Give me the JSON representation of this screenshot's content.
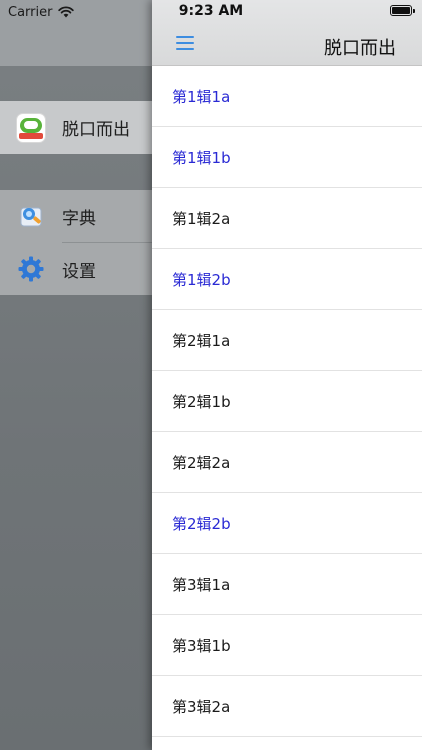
{
  "status_bar": {
    "carrier": "Carrier",
    "time": "9:23 AM"
  },
  "drawer": {
    "main_item": {
      "label": "脱口而出",
      "icon": "app-icon"
    },
    "items": [
      {
        "label": "字典",
        "icon": "dictionary-icon"
      },
      {
        "label": "设置",
        "icon": "gear-icon"
      }
    ]
  },
  "panel": {
    "title": "脱口而出",
    "menu_icon": "hamburger-icon",
    "list": [
      {
        "label": "第1辑1a",
        "state": "visited"
      },
      {
        "label": "第1辑1b",
        "state": "visited"
      },
      {
        "label": "第1辑2a",
        "state": "normal"
      },
      {
        "label": "第1辑2b",
        "state": "visited"
      },
      {
        "label": "第2辑1a",
        "state": "normal"
      },
      {
        "label": "第2辑1b",
        "state": "normal"
      },
      {
        "label": "第2辑2a",
        "state": "normal"
      },
      {
        "label": "第2辑2b",
        "state": "visited"
      },
      {
        "label": "第3辑1a",
        "state": "normal"
      },
      {
        "label": "第3辑1b",
        "state": "normal"
      },
      {
        "label": "第3辑2a",
        "state": "normal"
      }
    ]
  },
  "colors": {
    "visited_text": "#2a2ad4",
    "normal_text": "#1b1b1b",
    "accent": "#3d8de0"
  }
}
